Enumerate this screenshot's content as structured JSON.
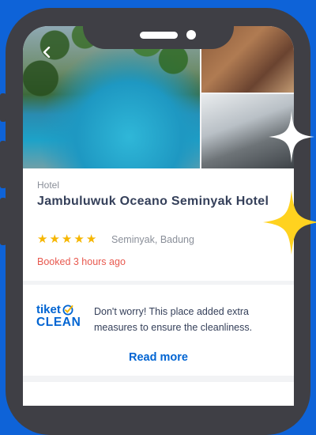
{
  "hotel": {
    "type": "Hotel",
    "name": "Jambuluwuk Oceano Seminyak Hotel",
    "rating": 5,
    "location": "Seminyak, Badung",
    "booked": "Booked 3 hours ago"
  },
  "clean": {
    "logo_line1": "tiket",
    "logo_line2": "CLEAN",
    "description": "Don't worry! This place added extra measures to ensure the cleanliness.",
    "read_more": "Read more"
  },
  "colors": {
    "background": "#0E63D8",
    "accent": "#0064D2",
    "star": "#F6B600",
    "booked": "#E8594F",
    "sparkle_yellow": "#FFD21F"
  },
  "icons": {
    "back": "chevron-left-icon",
    "check": "check-circle-icon"
  }
}
